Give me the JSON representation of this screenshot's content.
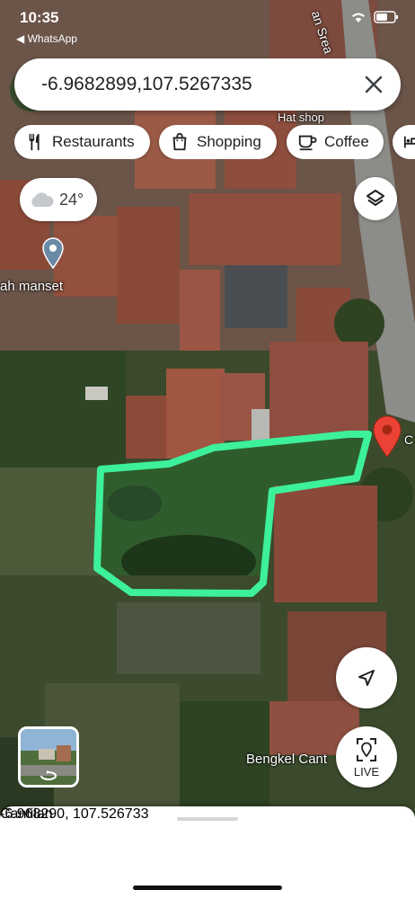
{
  "status": {
    "time": "10:35",
    "back_app": "◀ WhatsApp"
  },
  "search": {
    "value": "-6.9682899,107.5267335"
  },
  "chips": [
    {
      "label": "Restaurants",
      "icon": "fork-knife-icon"
    },
    {
      "label": "Shopping",
      "icon": "shopping-bag-icon"
    },
    {
      "label": "Coffee",
      "icon": "coffee-cup-icon"
    },
    {
      "label": "",
      "icon": "bed-icon"
    }
  ],
  "weather": {
    "temperature": "24°",
    "icon": "cloud-icon"
  },
  "map_labels": {
    "hat_shop": "Hat shop",
    "ah_manset": "ah manset",
    "bengkel": "Bengkel Cant",
    "pin_label": "C",
    "road": "an Srea"
  },
  "buttons": {
    "live": "LIVE"
  },
  "place": {
    "name": "Cantilan",
    "coords": "-6.968290, 107.526733"
  },
  "colors": {
    "boundary": "#3df09a",
    "pin": "#ea4335"
  }
}
